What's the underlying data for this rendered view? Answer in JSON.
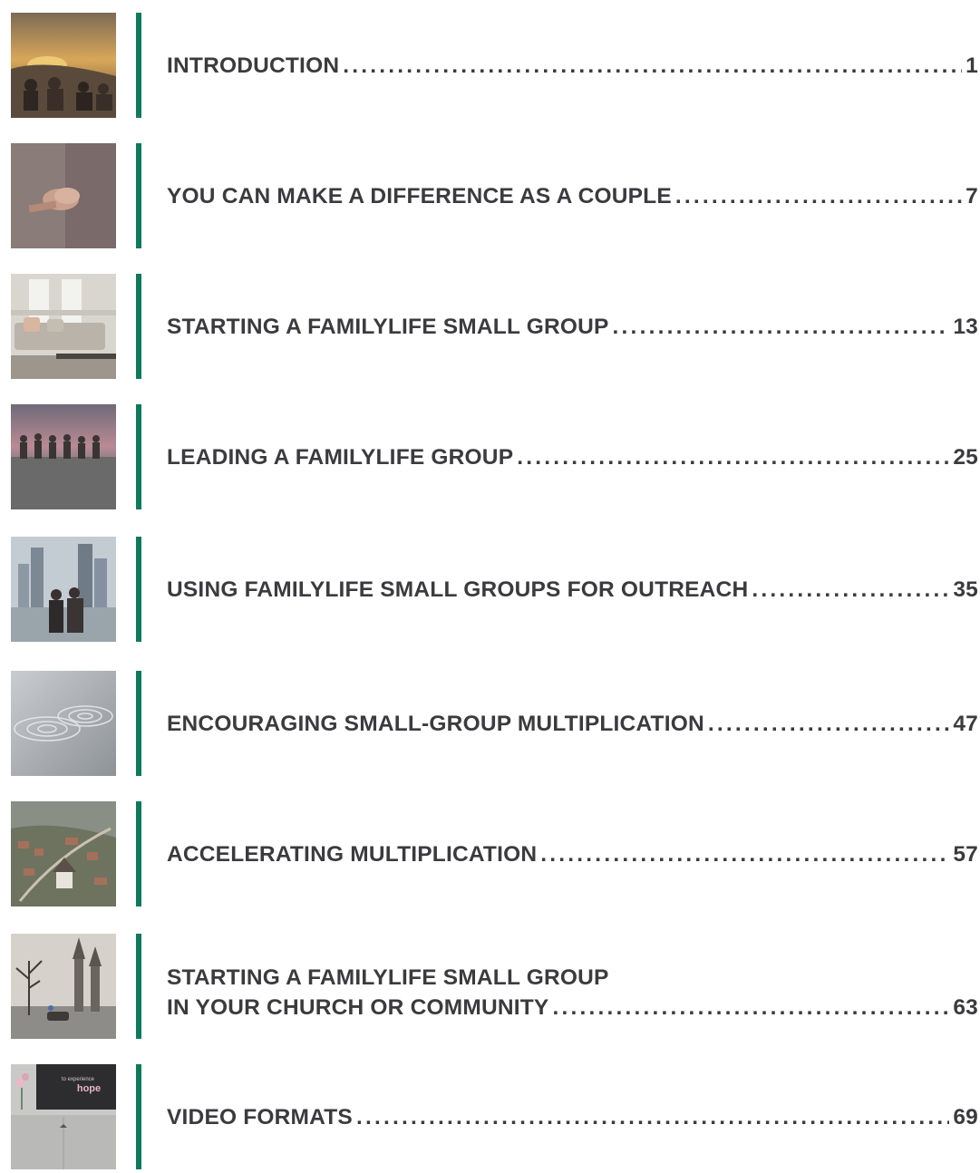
{
  "toc": {
    "accent_color": "#0f7a5b",
    "entries": [
      {
        "title_line1": "",
        "title": "INTRODUCTION",
        "page": "1",
        "image_icon": "sunset-group-photo-icon"
      },
      {
        "title_line1": "",
        "title": "YOU CAN MAKE A DIFFERENCE AS A COUPLE",
        "page": "7",
        "image_icon": "holding-hands-photo-icon"
      },
      {
        "title_line1": "",
        "title": "STARTING A FAMILYLIFE SMALL GROUP",
        "page": "13",
        "image_icon": "living-room-photo-icon"
      },
      {
        "title_line1": "",
        "title": "LEADING A FAMILYLIFE GROUP",
        "page": "25",
        "image_icon": "silhouettes-photo-icon"
      },
      {
        "title_line1": "",
        "title": "USING FAMILYLIFE SMALL GROUPS FOR OUTREACH",
        "page": "35",
        "image_icon": "city-couple-photo-icon"
      },
      {
        "title_line1": "",
        "title": "ENCOURAGING SMALL-GROUP MULTIPLICATION",
        "page": "47",
        "image_icon": "water-ripples-photo-icon"
      },
      {
        "title_line1": "",
        "title": "ACCELERATING MULTIPLICATION",
        "page": "57",
        "image_icon": "aerial-town-photo-icon"
      },
      {
        "title_line1": "STARTING A FAMILYLIFE SMALL GROUP",
        "title": "IN YOUR CHURCH OR COMMUNITY",
        "page": "63",
        "image_icon": "church-street-photo-icon"
      },
      {
        "title_line1": "",
        "title": "VIDEO FORMATS",
        "page": "69",
        "image_icon": "tv-screen-photo-icon"
      }
    ],
    "tv_caption_small": "to experience",
    "tv_caption_word": "hope"
  }
}
